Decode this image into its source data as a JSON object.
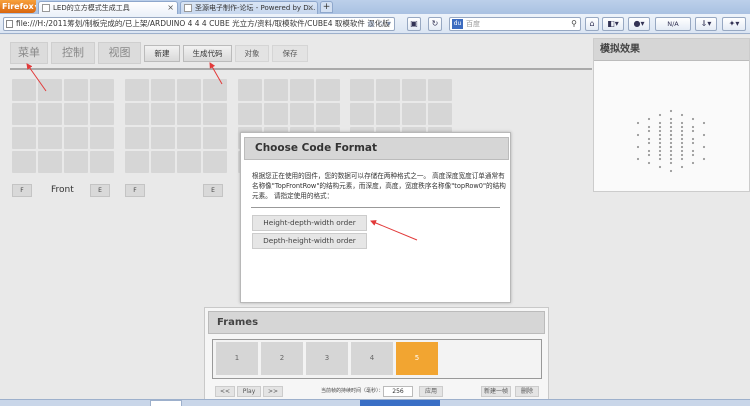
{
  "browser": {
    "menu_button": "Firefox",
    "tabs": [
      {
        "title": "LED的立方模式生成工具"
      },
      {
        "title": "圣源电子制作-论坛 - Powered by D..."
      }
    ],
    "new_tab": "+",
    "url": "file:///H:/2011筹划/制板完成的/已上架/ARDUINO 4 4 4 CUBE 光立方/资料/取模软件/CUBE4 取模软件 汉化版",
    "search_placeholder": "百度",
    "search_engine": "du",
    "addon_status": "N/A"
  },
  "toolbar": {
    "main_buttons": [
      "菜单",
      "控制",
      "视图"
    ],
    "sub_buttons": [
      "新建",
      "生成代码",
      "对象",
      "保存"
    ]
  },
  "layers": {
    "front_label": "Front",
    "buttons": [
      "F",
      "E",
      "F",
      "E"
    ]
  },
  "sim_panel": {
    "title": "模拟效果"
  },
  "dialog": {
    "title": "Choose Code Format",
    "description": "根据您正在使用的固件，您的数据可以存储在两种格式之一。 高度深度宽度订单通常有名称像\"TopFrontRow\"的结构元素，而深度，高度，宽度秩序名称像\"topRow0\"的结构元素。 请指定使用的格式：",
    "options": [
      "Height-depth-width order",
      "Depth-height-width order"
    ]
  },
  "frames": {
    "title": "Frames",
    "items": [
      "1",
      "2",
      "3",
      "4",
      "5"
    ],
    "selected_index": 4,
    "controls": {
      "prev": "<<",
      "play": "Play",
      "next": ">>",
      "delay_label": "当前帧的持续时间（毫秒）：",
      "delay_value": "256",
      "apply": "应用",
      "new_frame": "新建一帧",
      "delete": "删除"
    }
  },
  "colors": {
    "accent_selected_frame": "#f2a531",
    "annotation_arrow": "#e23a3a"
  }
}
